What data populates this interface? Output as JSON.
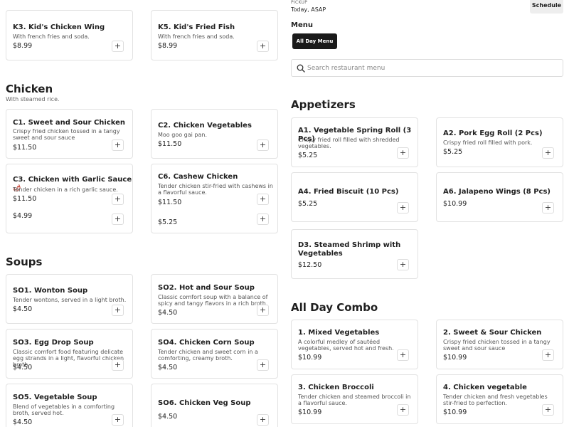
{
  "header": {
    "pickup_label": "PICKUP",
    "pickup_value": "Today, ASAP",
    "schedule_label": "Schedule",
    "menu_title": "Menu",
    "menu_tab": "All Day Menu",
    "search_placeholder": "Search restaurant menu"
  },
  "kids": {
    "items": [
      {
        "name": "K3. Kid's Chicken Wing",
        "desc": "With french fries and soda.",
        "price": "$8.99"
      },
      {
        "name": "K5. Kid's Fried Fish",
        "desc": "With french fries and soda.",
        "price": "$8.99"
      }
    ]
  },
  "chicken": {
    "title": "Chicken",
    "subtitle": "With steamed rice.",
    "items": [
      {
        "name": "C1. Sweet and Sour Chicken",
        "desc": "Crispy fried chicken tossed in a tangy sweet and sour sauce",
        "price": "$11.50"
      },
      {
        "name": "C2. Chicken Vegetables",
        "desc": "Moo goo gai pan.",
        "price": "$11.50"
      },
      {
        "name": "C3. Chicken with Garlic Sauce",
        "desc": "Tender chicken in a rich garlic sauce.",
        "price": "$11.50",
        "price_below": "$4.99"
      },
      {
        "name": "C6. Cashew Chicken",
        "desc": "Tender chicken stir-fried with cashews in a flavorful sauce.",
        "price": "$11.50",
        "price_below": "$5.25"
      }
    ]
  },
  "soups": {
    "title": "Soups",
    "items": [
      {
        "name": "SO1. Wonton Soup",
        "desc": "Tender wontons, served in a light broth.",
        "price": "$4.50"
      },
      {
        "name": "SO2. Hot and Sour Soup",
        "desc": "Classic comfort soup with a balance of spicy and tangy flavors in a rich broth.",
        "price": "$4.50"
      },
      {
        "name": "SO3. Egg Drop Soup",
        "desc": "Classic comfort food featuring delicate egg strands in a light, flavorful chicken broth.",
        "price": "$4.50"
      },
      {
        "name": "SO4. Chicken Corn Soup",
        "desc": "Tender chicken and sweet corn in a comforting, creamy broth.",
        "price": "$4.50"
      },
      {
        "name": "SO5. Vegetable Soup",
        "desc": "Blend of vegetables in a comforting broth, served hot.",
        "price": "$4.50"
      },
      {
        "name": "SO6. Chicken Veg Soup",
        "desc": "",
        "price": "$4.50"
      }
    ]
  },
  "appetizers": {
    "title": "Appetizers",
    "items": [
      {
        "name": "A1. Vegetable Spring Roll (3 Pcs)",
        "desc": "Crispy fried roll filled with shredded vegetables.",
        "price": "$5.25"
      },
      {
        "name": "A2. Pork Egg Roll (2 Pcs)",
        "desc": "Crispy fried roll filled with pork.",
        "price": "$5.25"
      },
      {
        "name": "A4. Fried Biscuit (10 Pcs)",
        "desc": "",
        "price": "$5.25"
      },
      {
        "name": "A6. Jalapeno Wings (8 Pcs)",
        "desc": "",
        "price": "$10.99"
      },
      {
        "name": "D3. Steamed Shrimp with Vegetables",
        "desc": "",
        "price": "$12.50"
      }
    ]
  },
  "combo": {
    "title": "All Day Combo",
    "items": [
      {
        "name": "1. Mixed Vegetables",
        "desc": "A colorful medley of sautéed vegetables, served hot and fresh.",
        "price": "$10.99"
      },
      {
        "name": "2. Sweet & Sour Chicken",
        "desc": "Crispy fried chicken tossed in a tangy sweet and sour sauce",
        "price": "$10.99"
      },
      {
        "name": "3. Chicken Broccoli",
        "desc": "Tender chicken and steamed broccoli in a flavorful sauce.",
        "price": "$10.99"
      },
      {
        "name": "4. Chicken vegetable",
        "desc": "Tender chicken and fresh vegetables stir-fried to perfection.",
        "price": "$10.99"
      }
    ]
  },
  "add_label": "+"
}
